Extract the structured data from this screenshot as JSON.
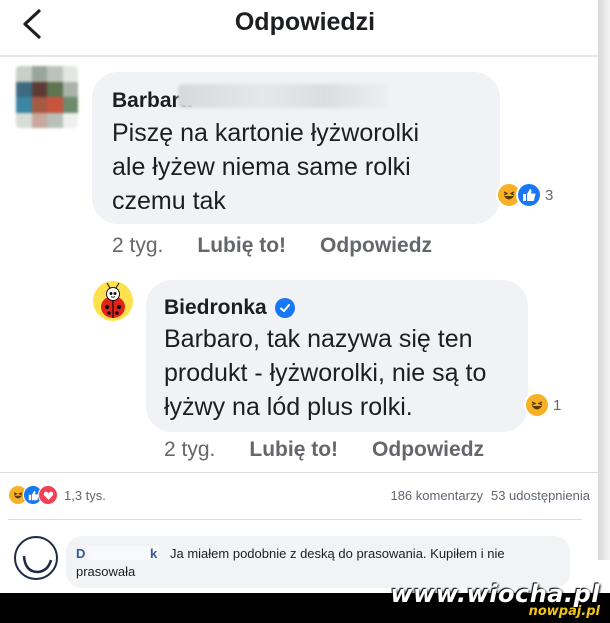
{
  "header": {
    "title": "Odpowiedzi",
    "back_icon": "chevron-left-icon"
  },
  "comment1": {
    "author": "Barbara",
    "text": "Piszę na kartonie łyżworolki ale łyżew niema same rolki czemu tak",
    "time": "2 tyg.",
    "like_action": "Lubię to!",
    "reply_action": "Odpowiedz",
    "reactions": [
      "haha",
      "like"
    ],
    "reaction_count": "3"
  },
  "reply1": {
    "author": "Biedronka",
    "verified": true,
    "text": "Barbaro, tak nazywa się ten produkt - łyżworolki, nie są to łyżwy na lód plus rolki.",
    "time": "2 tyg.",
    "like_action": "Lubię to!",
    "reply_action": "Odpowiedz",
    "reactions": [
      "haha"
    ],
    "reaction_count": "1"
  },
  "post_summary": {
    "reactions": [
      "haha",
      "like",
      "love"
    ],
    "reaction_total": "1,3 tys.",
    "comments": "186 komentarzy",
    "shares": "53 udostępnienia"
  },
  "comment2": {
    "author_visible_start": "D",
    "author_visible_end": "k",
    "text": "Ja miałem podobnie z deską do prasowania. Kupiłem i nie prasowała"
  },
  "watermark": {
    "main": "www.wiocha.pl",
    "sub": "nowpaj.pl"
  },
  "colors": {
    "bubble": "#f0f2f5",
    "accent": "#1877f2",
    "haha": "#f7b125",
    "love": "#f33e58",
    "meta_text": "#65676b"
  }
}
